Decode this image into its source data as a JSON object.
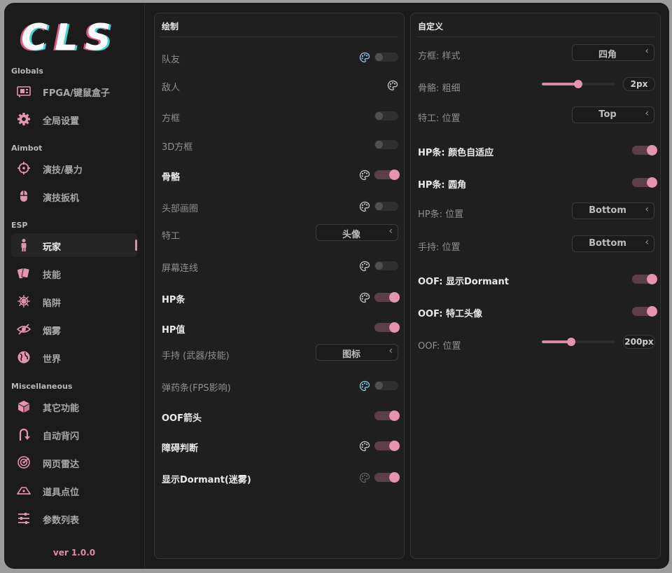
{
  "app": {
    "logo_text": "CLS",
    "version": "ver 1.0.0"
  },
  "colors": {
    "accent": "#e494ac",
    "bg": "#1b1b1b",
    "panel": "#1f1f1f"
  },
  "sidebar": {
    "sections": [
      {
        "label": "Globals",
        "items": [
          {
            "label": "FPGA/键鼠盒子",
            "icon": "fpga-card-icon"
          },
          {
            "label": "全局设置",
            "icon": "gear-icon"
          }
        ]
      },
      {
        "label": "Aimbot",
        "items": [
          {
            "label": "演技/暴力",
            "icon": "crosshair-icon"
          },
          {
            "label": "演技扳机",
            "icon": "mouse-icon"
          }
        ]
      },
      {
        "label": "ESP",
        "items": [
          {
            "label": "玩家",
            "icon": "person-icon",
            "active": true
          },
          {
            "label": "技能",
            "icon": "cards-icon"
          },
          {
            "label": "陷阱",
            "icon": "spiderweb-icon"
          },
          {
            "label": "烟雾",
            "icon": "eye-slash-icon"
          },
          {
            "label": "世界",
            "icon": "globe-icon"
          }
        ]
      },
      {
        "label": "Miscellaneous",
        "items": [
          {
            "label": "其它功能",
            "icon": "cube-icon"
          },
          {
            "label": "自动背闪",
            "icon": "u-turn-icon"
          },
          {
            "label": "网页雷达",
            "icon": "radar-icon"
          },
          {
            "label": "道具点位",
            "icon": "map-marker-icon"
          },
          {
            "label": "参数列表",
            "icon": "sliders-icon"
          }
        ]
      }
    ]
  },
  "draw_panel": {
    "title": "绘制",
    "rows": [
      {
        "label": "队友",
        "palette": "blue",
        "toggle": false,
        "bold": false
      },
      {
        "label": "敌人",
        "palette": "grey",
        "bold": false
      },
      {
        "label": "方框",
        "toggle": false,
        "bold": false
      },
      {
        "label": "3D方框",
        "toggle": false,
        "bold": false
      },
      {
        "label": "骨骼",
        "palette": "grey",
        "toggle": true,
        "bold": true
      },
      {
        "label": "头部画圈",
        "palette": "grey",
        "toggle": false,
        "bold": false
      },
      {
        "label": "特工",
        "select": "头像",
        "bold": false
      },
      {
        "label": "屏幕连线",
        "palette": "grey",
        "toggle": false,
        "bold": false
      },
      {
        "label": "HP条",
        "palette": "grey",
        "toggle": true,
        "bold": true
      },
      {
        "label": "HP值",
        "toggle": true,
        "bold": true
      },
      {
        "label": "手持 (武器/技能)",
        "select": "图标",
        "bold": false
      },
      {
        "label": "弹药条(FPS影响)",
        "palette": "blue",
        "toggle": false,
        "bold": false
      },
      {
        "label": "OOF箭头",
        "toggle": true,
        "bold": true
      },
      {
        "label": "障碍判断",
        "palette": "grey",
        "toggle": true,
        "bold": true
      },
      {
        "label": "显示Dormant(迷雾)",
        "palette": "dim",
        "toggle": true,
        "bold": true
      }
    ]
  },
  "custom_panel": {
    "title": "自定义",
    "rows": [
      {
        "label": "方框: 样式",
        "select": "四角",
        "bold": false
      },
      {
        "label": "骨骼: 粗细",
        "slider": 0.5,
        "value": "2px",
        "bold": false
      },
      {
        "label": "特工: 位置",
        "select": "Top",
        "bold": false
      },
      {
        "label": "HP条: 颜色自适应",
        "toggle": true,
        "bold": true
      },
      {
        "label": "HP条: 圆角",
        "toggle": true,
        "bold": true
      },
      {
        "label": "HP条: 位置",
        "select": "Bottom",
        "bold": false
      },
      {
        "label": "手持: 位置",
        "select": "Bottom",
        "bold": false
      },
      {
        "label": "OOF: 显示Dormant",
        "toggle": true,
        "bold": true
      },
      {
        "label": "OOF: 特工头像",
        "toggle": true,
        "bold": true
      },
      {
        "label": "OOF: 位置",
        "slider": 0.4,
        "value": "200px",
        "bold": false
      }
    ]
  }
}
